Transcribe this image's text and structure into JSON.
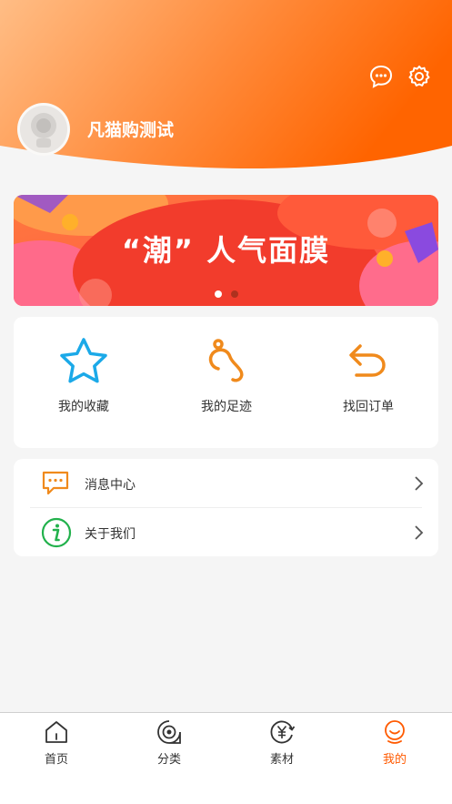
{
  "header": {
    "username": "凡猫购测试",
    "message_icon": "chat-bubble-icon",
    "settings_icon": "gear-icon"
  },
  "banner": {
    "title": "“潮” 人气面膜",
    "slide_count": 2,
    "active_slide": 1
  },
  "quick_actions": [
    {
      "label": "我的收藏",
      "icon": "star-icon",
      "color": "#1ba9e8"
    },
    {
      "label": "我的足迹",
      "icon": "footprint-icon",
      "color": "#f08a1c"
    },
    {
      "label": "找回订单",
      "icon": "undo-arrow-icon",
      "color": "#f08a1c"
    }
  ],
  "menu": [
    {
      "label": "消息中心",
      "icon": "message-icon",
      "color": "#f08a1c"
    },
    {
      "label": "关于我们",
      "icon": "info-icon",
      "color": "#22b14c"
    }
  ],
  "tabbar": [
    {
      "label": "首页",
      "icon": "home-icon",
      "active": false
    },
    {
      "label": "分类",
      "icon": "category-icon",
      "active": false
    },
    {
      "label": "素材",
      "icon": "material-icon",
      "active": false
    },
    {
      "label": "我的",
      "icon": "profile-icon",
      "active": true
    }
  ],
  "colors": {
    "accent": "#ff5a00",
    "header_start": "#ffb070",
    "header_end": "#ff6a00"
  }
}
